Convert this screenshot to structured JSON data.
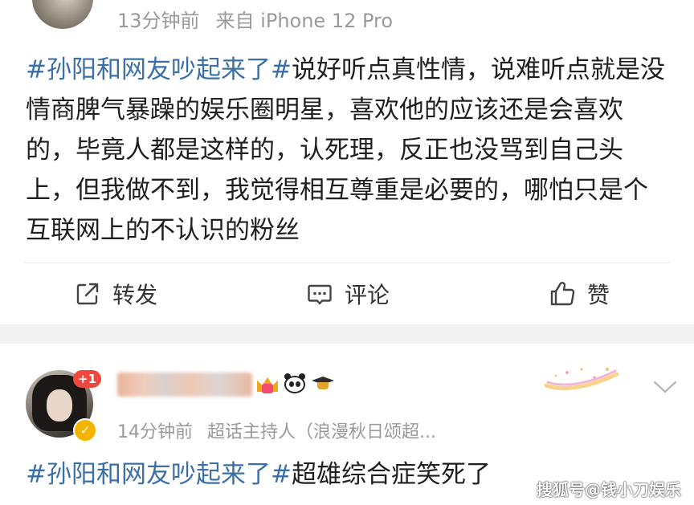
{
  "post1": {
    "time": "13分钟前",
    "source": "来自 iPhone 12 Pro",
    "topic": "#孙阳和网友吵起来了#",
    "text": "说好听点真性情，说难听点就是没情商脾气暴躁的娱乐圈明星，喜欢他的应该还是会喜欢的，毕竟人都是这样的，认死理，反正也没骂到自己头上，但我做不到，我觉得相互尊重是必要的，哪怕只是个互联网上的不认识的粉丝",
    "actions": {
      "repost_label": "转发",
      "comment_label": "评论",
      "like_label": "赞"
    }
  },
  "post2": {
    "badge": "+1",
    "time": "14分钟前",
    "meta_role": "超话主持人（浪漫秋日颂超...",
    "topic": "#孙阳和网友吵起来了#",
    "text": "超雄综合症笑死了"
  },
  "watermark": "搜狐号@钱小刀娱乐",
  "colors": {
    "topic": "#3a6fa8",
    "meta": "#9a9a9a",
    "badge": "#f0483e",
    "verify": "#f5b400",
    "separator": "#f2f2f2"
  },
  "icons": {
    "repost": "repost-icon",
    "comment": "comment-icon",
    "like": "thumbs-up-icon",
    "more": "chevron-down-icon"
  }
}
